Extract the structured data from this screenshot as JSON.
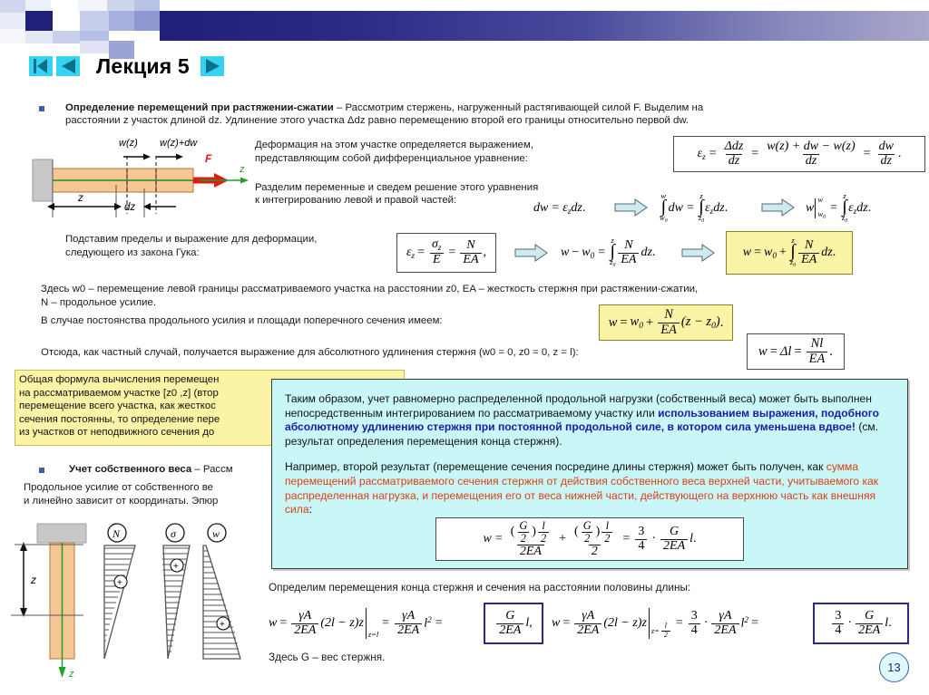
{
  "slide": {
    "title": "Лекция 5",
    "page_number": "13",
    "nav": {
      "first_label": "first-slide",
      "prev_label": "previous-slide",
      "next_label": "next-slide"
    }
  },
  "body": {
    "b1_head": "Определение перемещений при растяжении-сжатии",
    "b1_line1_rest": " – Рассмотрим стержень, нагруженный растягивающей силой F. Выделим на",
    "b1_line2": "расстоянии z участок длиной dz. Удлинение этого участка Δdz равно перемещению второй его границы относительно первой dw.",
    "p_def_l1": "Деформация на этом участке определяется выражением,",
    "p_def_l2": "представляющим собой дифференциальное уравнение:",
    "p_sep_l1": "Разделим переменные и сведем решение этого уравнения",
    "p_sep_l2": "к интегрированию левой и правой частей:",
    "p_lim_l1": "Подставим пределы и выражение для деформации,",
    "p_lim_l2": "следующего из закона Гука:",
    "p_here_l1": "Здесь w0 – перемещение левой границы рассматриваемого участка на расстоянии z0, EA – жесткость стержня при растяжении-сжатии,",
    "p_here_l2": "N – продольное усилие.",
    "p_const": "В случае постоянства продольного усилия и площади поперечного сечения имеем:",
    "p_hence": "Отсюда, как частный случай, получается выражение для абсолютного удлинения стержня (w0 = 0, z0 = 0, z = l):",
    "b2_head": "Учет собственного веса",
    "b2_rest": " – Рассм",
    "p_w_l1": "Продольное усилие от собственного ве",
    "p_w_l2": "и линейно зависит от координаты. Эпюр",
    "p_determine": "Определим перемещения конца стержня и сечения на расстоянии половины длины:",
    "p_gweight": "Здесь G – вес стержня."
  },
  "yellow_note": {
    "l1": "Общая формула вычисления перемещен",
    "l2": "на рассматриваемом участке [z0 ,z] (втор",
    "l3": "перемещение всего участка, как жесткос",
    "l4": "сечения постоянны, то определение пере",
    "l5": "из участков от неподвижного сечения до"
  },
  "callout": {
    "p1": [
      {
        "t": "Таким образом, учет равномерно распределенной продольной нагрузки (собственный веса) может быть выполнен непосредственным интегрированием по рассматриваемому участку или ",
        "s": "plain"
      },
      {
        "t": "использованием выражения, подобного абсолютному удлинению стержня при постоянной продольной силе, в котором сила уменьшена вдвое!",
        "s": "navy"
      },
      {
        "t": " (см. результат определения перемещения конца стержня).",
        "s": "plain"
      }
    ],
    "p2": [
      {
        "t": "Например, второй результат (перемещение сечения посредине длины стержня) может быть получен, как ",
        "s": "plain"
      },
      {
        "t": "сумма перемещений рассматриваемого сечения стержня от действия собственного веса верхней части, учитываемого как распределенная нагрузка,  и перемещения его от веса нижней части, действующего на верхнюю часть как внешняя сила",
        "s": "red"
      },
      {
        "t": ":",
        "s": "plain"
      }
    ]
  },
  "diagram_top": {
    "label_wz": "w(z)",
    "label_wzdw": "w(z)+dw",
    "label_F": "F",
    "label_z_axis": "z",
    "label_z_dim": "z",
    "label_dz": "dz"
  },
  "diagram_bottom": {
    "label_z_dim": "z",
    "label_z_axis": "z",
    "circle_N": "N",
    "circle_sigma": "σ",
    "circle_w": "w",
    "plus": "+"
  },
  "formulas": {
    "eps_def": "ε_z = Δdz/dz = (w(z)+dw−w(z))/dz = dw/dz.",
    "dw_eps": "dw = ε_z dz.",
    "int_dw": "∫(w0..w) dw = ∫(z0..z) ε_z dz.",
    "w_bar": "w|(w0..w) = ∫(z0..z) ε_z dz.",
    "hooke": "ε_z = σ_z/E = N/(EA),",
    "w_minus_w0": "w − w0 = ∫(z0..z) N/(EA) dz.",
    "w_eq_w0_int": "w = w0 + ∫(z0..z) N/(EA) dz.",
    "w_eq_w0_lin": "w = w0 + N/(EA) (z − z0).",
    "delta_l": "w = Δl = Nl/(EA).",
    "sum_halves": "w = (G/2)(l/2)/(2EA) + (G/2)(l/2)/2 = 3/4 · G/(2EA) l.",
    "end_disp": "w = γA/(2EA) (2l − z) z |z=l = γA/(2EA) l² = G/(2EA) l,",
    "mid_disp": "w = γA/(2EA) (2l − z) z |z=l/2 = 3/4 · γA/(2EA) l² = 3/4 · G/(2EA) l."
  },
  "colors": {
    "accent_navy": "#20207a",
    "nav_cyan": "#35d2f2",
    "callout_bg": "#c9f7f7",
    "note_yellow": "#fbf3a6",
    "force_red": "#e01b10",
    "axis_green": "#1fa02a",
    "rod_fill": "#f5c795"
  }
}
